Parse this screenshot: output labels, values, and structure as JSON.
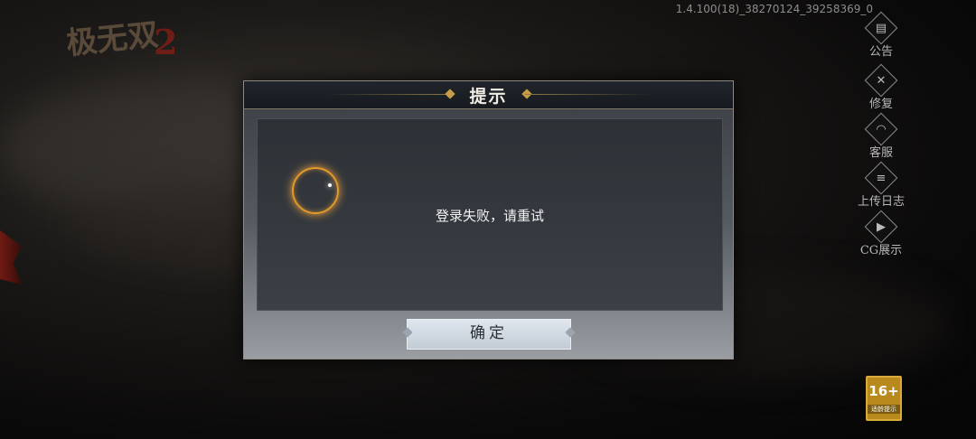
{
  "game": {
    "logo_text": "极无双2",
    "version": "1.4.100(18)_38270124_39258369_0"
  },
  "side_menu": [
    {
      "label": "公告",
      "icon": "notice-icon",
      "glyph": "▤"
    },
    {
      "label": "修复",
      "icon": "wrench-icon",
      "glyph": "✕"
    },
    {
      "label": "客服",
      "icon": "headset-icon",
      "glyph": "◠"
    },
    {
      "label": "上传日志",
      "icon": "upload-log-icon",
      "glyph": "≡"
    },
    {
      "label": "CG展示",
      "icon": "video-icon",
      "glyph": "▶"
    }
  ],
  "dialog": {
    "title": "提示",
    "message": "登录失败，请重试",
    "ok_label": "确定"
  },
  "age_rating": {
    "number": "16+",
    "text": "适龄提示"
  },
  "colors": {
    "spinner": "#e39a2c",
    "title_ornament": "#c79b48"
  }
}
